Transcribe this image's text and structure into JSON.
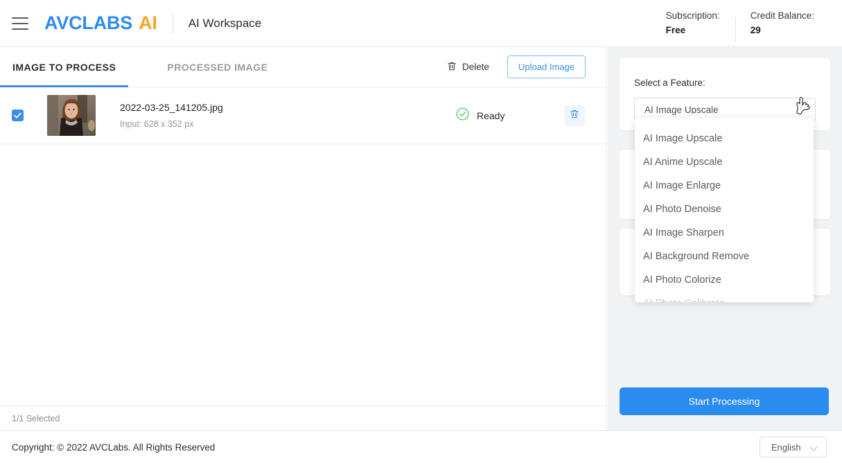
{
  "header": {
    "menu_icon": "hamburger-icon",
    "brand_primary": "AVCLABS",
    "brand_accent": "AI",
    "workspace_title": "AI Workspace",
    "subscription_label": "Subscription:",
    "subscription_value": "Free",
    "credit_label": "Credit Balance:",
    "credit_value": "29"
  },
  "tabs": [
    {
      "label": "IMAGE TO PROCESS",
      "active": true
    },
    {
      "label": "PROCESSED IMAGE",
      "active": false
    }
  ],
  "toolbar": {
    "delete_label": "Delete",
    "delete_icon": "trash-icon",
    "upload_label": "Upload Image"
  },
  "file_list": {
    "rows": [
      {
        "checked": true,
        "name": "2022-03-25_141205.jpg",
        "dimensions": "Input: 628 x 352 px",
        "status": "Ready",
        "status_icon": "check-circle-icon",
        "row_delete_icon": "trash-icon"
      }
    ],
    "selected_text": "1/1 Selected"
  },
  "right_panel": {
    "select_label": "Select a Feature:",
    "selected_feature": "AI Image Upscale",
    "dropdown_icon": "chevron-down-icon",
    "options": [
      "AI Image Upscale",
      "AI Anime Upscale",
      "AI Image Enlarge",
      "AI Photo Denoise",
      "AI Image Sharpen",
      "AI Background Remove",
      "AI Photo Colorize",
      "AI Photo Calibrate"
    ],
    "start_button": "Start Processing"
  },
  "footer": {
    "copyright": "Copyright: © 2022 AVCLabs. All Rights Reserved",
    "language": "English",
    "language_icon": "chevron-down-icon"
  },
  "colors": {
    "brand_blue": "#2d8cf0",
    "brand_orange": "#f5a623",
    "accent_blue": "#3a8ee6",
    "primary_button": "#2b8cf0",
    "status_green": "#3fbf5f",
    "panel_bg": "#f2f3f5"
  }
}
